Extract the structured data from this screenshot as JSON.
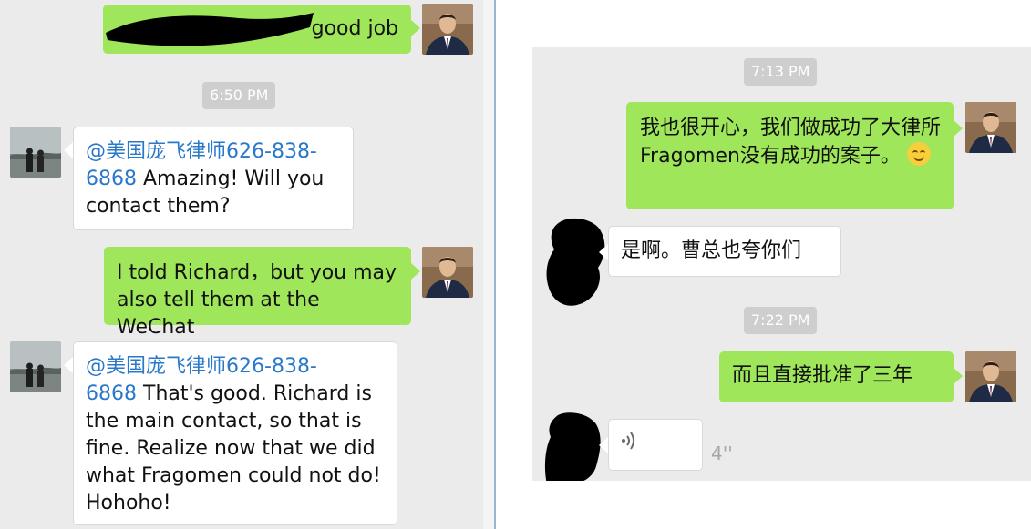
{
  "left_chat": {
    "messages": [
      {
        "side": "right",
        "text": "good job"
      },
      {
        "side": "time",
        "text": "6:50 PM"
      },
      {
        "side": "left",
        "mention": "@美国庞飞律师",
        "phone_a": "626-838-",
        "phone_b": "6868",
        "text": "Amazing! Will you contact them?"
      },
      {
        "side": "right",
        "text": "I told Richard，but you may also tell them at the WeChat"
      },
      {
        "side": "left",
        "mention": "@美国庞飞律师",
        "phone_a": "626-838-",
        "phone_b": "6868",
        "text": "That's good.  Richard is the main contact, so that is fine.  Realize now that we did what Fragomen could not do! Hohoho!"
      }
    ]
  },
  "right_chat": {
    "messages": [
      {
        "side": "time",
        "text": "7:13 PM"
      },
      {
        "side": "right",
        "text": "我也很开心，我们做成功了大律所Fragomen没有成功的案子。"
      },
      {
        "side": "left",
        "text": "是啊。曹总也夸你们"
      },
      {
        "side": "time",
        "text": "7:22 PM"
      },
      {
        "side": "right",
        "text": "而且直接批准了三年"
      },
      {
        "side": "left",
        "voice_icon": "voice-wave-icon",
        "duration": "4''"
      }
    ]
  },
  "colors": {
    "green_bubble": "#9fe65a",
    "chat_bg": "#ebebeb",
    "mention": "#2a78c9",
    "time_badge": "#cecece"
  },
  "icons": [
    "lawyer-avatar",
    "contact-avatar-photo",
    "redacted-avatar",
    "smile-emoji-icon",
    "voice-wave-icon"
  ]
}
